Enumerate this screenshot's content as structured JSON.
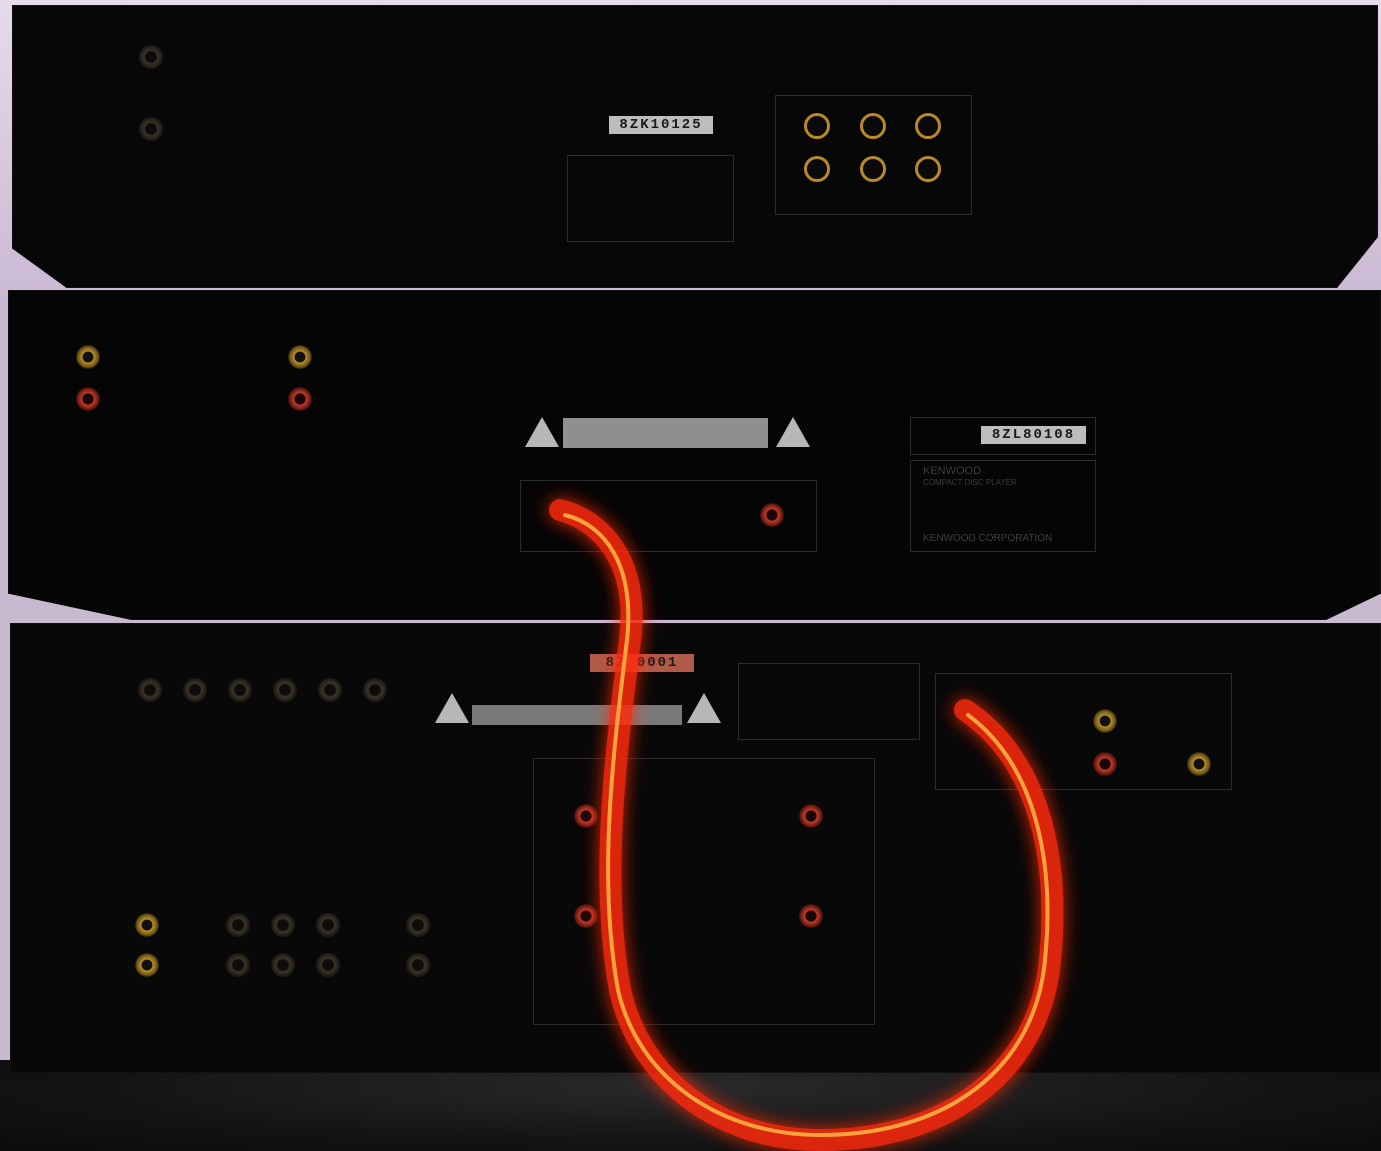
{
  "top_unit": {
    "serial": "8ZK10125"
  },
  "middle_unit": {
    "serial": "8ZL80108",
    "brand": "KENWOOD",
    "product": "COMPACT DISC PLAYER",
    "maker": "KENWOOD CORPORATION"
  },
  "bottom_unit": {
    "serial": "8Z 0001"
  },
  "cable_color": "#ff3a1a"
}
